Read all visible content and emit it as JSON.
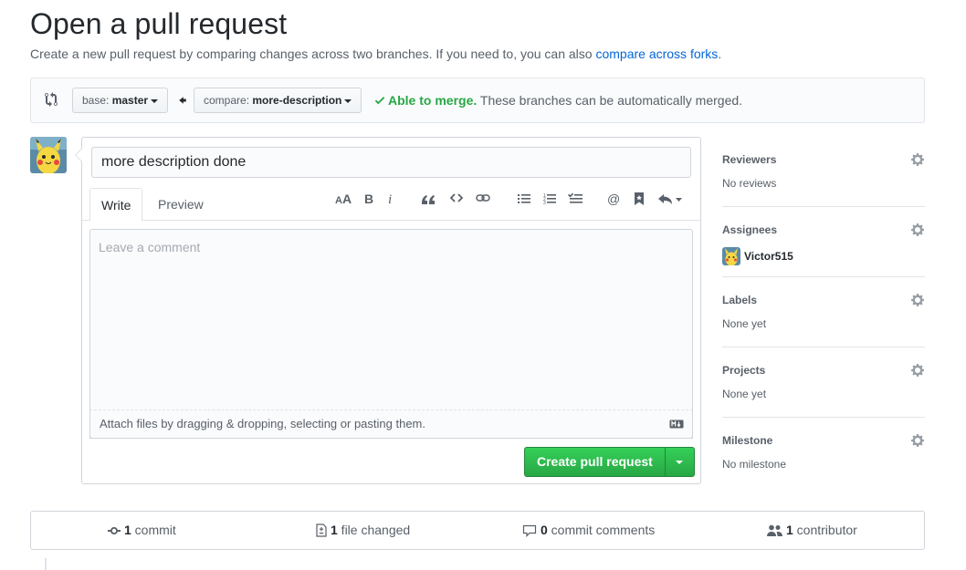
{
  "header": {
    "title": "Open a pull request",
    "subtitle_prefix": "Create a new pull request by comparing changes across two branches. If you need to, you can also ",
    "subtitle_link": "compare across forks",
    "subtitle_suffix": "."
  },
  "range": {
    "base_prefix": "base: ",
    "base_branch": "master",
    "compare_prefix": "compare: ",
    "compare_branch": "more-description",
    "merge_status": "Able to merge.",
    "merge_message": " These branches can be automatically merged."
  },
  "compose": {
    "title_value": "more description done",
    "tabs": [
      {
        "label": "Write",
        "active": true
      },
      {
        "label": "Preview",
        "active": false
      }
    ],
    "toolbar_icons": [
      "text-size-icon",
      "bold-icon",
      "italic-icon",
      "quote-icon",
      "code-icon",
      "link-icon",
      "unordered-list-icon",
      "ordered-list-icon",
      "task-list-icon",
      "mention-icon",
      "saved-reply-icon",
      "reply-icon"
    ],
    "placeholder": "Leave a comment",
    "attach_text": "Attach files by dragging & dropping, selecting or pasting them.",
    "submit_label": "Create pull request"
  },
  "sidebar": {
    "sections": [
      {
        "heading": "Reviewers",
        "value": "No reviews"
      },
      {
        "heading": "Assignees",
        "value": "Victor515"
      },
      {
        "heading": "Labels",
        "value": "None yet"
      },
      {
        "heading": "Projects",
        "value": "None yet"
      },
      {
        "heading": "Milestone",
        "value": "No milestone"
      }
    ]
  },
  "summary": {
    "commits_count": "1",
    "commits_label": " commit",
    "files_count": "1",
    "files_label": " file changed",
    "comments_count": "0",
    "comments_label": " commit comments",
    "contributors_count": "1",
    "contributors_label": " contributor"
  },
  "colors": {
    "accent_link": "#0366d6",
    "success": "#28a745",
    "button_green": "#2ea44f"
  }
}
